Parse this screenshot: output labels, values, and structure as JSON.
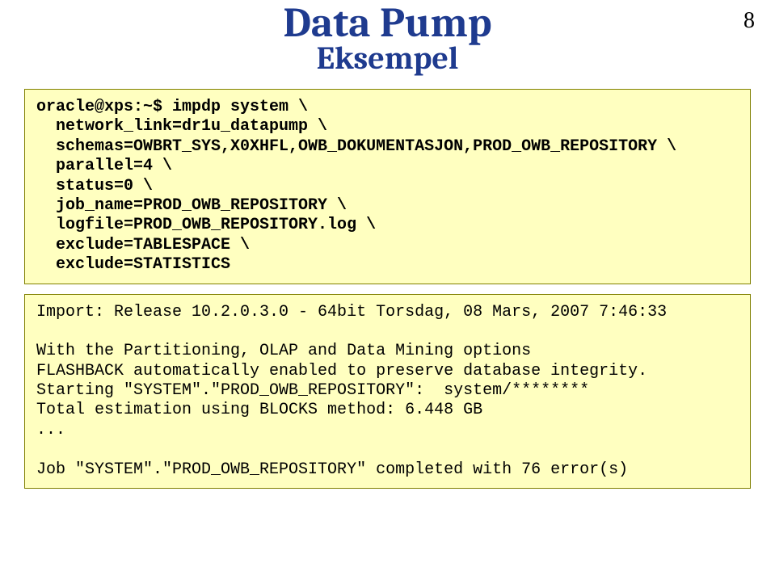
{
  "page_number": "8",
  "title": "Data Pump",
  "subtitle": "Eksempel",
  "box1": {
    "l1": "oracle@xps:~$ impdp system \\",
    "l2": "  network_link=dr1u_datapump \\",
    "l3": "  schemas=OWBRT_SYS,X0XHFL,OWB_DOKUMENTASJON,PROD_OWB_REPOSITORY \\",
    "l4": "  parallel=4 \\",
    "l5": "  status=0 \\",
    "l6": "  job_name=PROD_OWB_REPOSITORY \\",
    "l7": "  logfile=PROD_OWB_REPOSITORY.log \\",
    "l8": "  exclude=TABLESPACE \\",
    "l9": "  exclude=STATISTICS"
  },
  "box2": {
    "l1": "Import: Release 10.2.0.3.0 - 64bit Torsdag, 08 Mars, 2007 7:46:33",
    "blank1": "",
    "l2": "With the Partitioning, OLAP and Data Mining options",
    "l3": "FLASHBACK automatically enabled to preserve database integrity.",
    "l4": "Starting \"SYSTEM\".\"PROD_OWB_REPOSITORY\":  system/********",
    "l5": "Total estimation using BLOCKS method: 6.448 GB",
    "l6": "...",
    "blank2": "",
    "l7": "Job \"SYSTEM\".\"PROD_OWB_REPOSITORY\" completed with 76 error(s)"
  }
}
